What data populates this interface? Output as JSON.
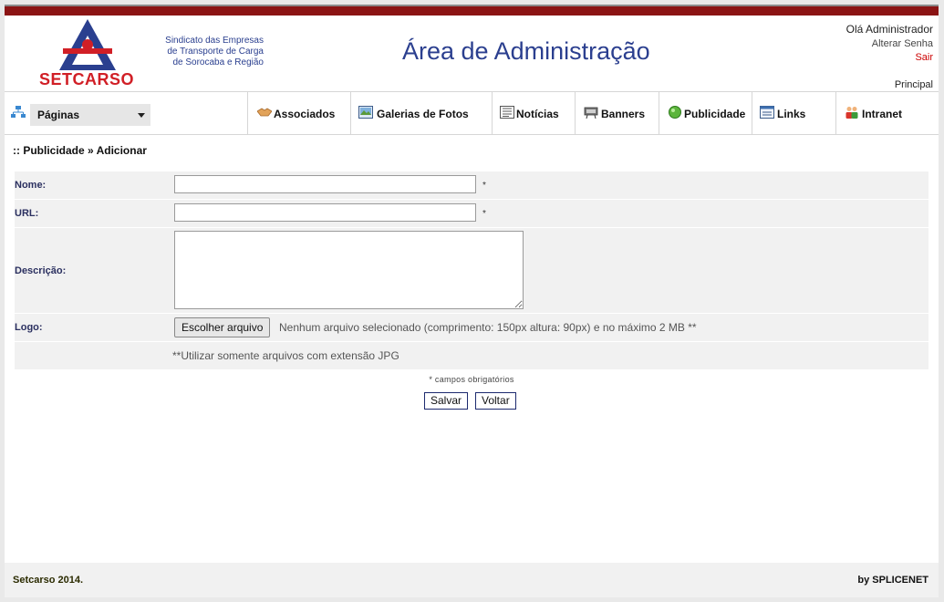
{
  "header": {
    "logo_text": "SETCARSO",
    "logo_subtitle": [
      "Sindicato das Empresas",
      "de Transporte de Carga",
      "de Sorocaba e Região"
    ],
    "title": "Área de Administração",
    "greeting": "Olá Administrador",
    "change_password": "Alterar Senha",
    "logout": "Sair",
    "home": "Principal"
  },
  "menu": {
    "pages_label": "Páginas",
    "items": [
      {
        "label": "Associados",
        "icon": "handshake-icon"
      },
      {
        "label": "Galerias de Fotos",
        "icon": "photo-gallery-icon"
      },
      {
        "label": "Notícias",
        "icon": "news-icon"
      },
      {
        "label": "Banners",
        "icon": "banner-icon"
      },
      {
        "label": "Publicidade",
        "icon": "green-circle-icon"
      },
      {
        "label": "Links",
        "icon": "links-icon"
      },
      {
        "label": "Intranet",
        "icon": "people-icon"
      }
    ]
  },
  "breadcrumb": ":: Publicidade » Adicionar",
  "form": {
    "name_label": "Nome:",
    "name_value": "",
    "url_label": "URL:",
    "url_value": "",
    "required_mark": "*",
    "description_label": "Descrição:",
    "description_value": "",
    "logo_label": "Logo:",
    "file_button": "Escolher arquivo",
    "file_info": "Nenhum arquivo selecionado  (comprimento: 150px altura: 90px) e no máximo 2 MB **",
    "jpg_note": "**Utilizar somente arquivos com extensão JPG",
    "required_note": "* campos obrigatórios",
    "save_label": "Salvar",
    "back_label": "Voltar"
  },
  "footer": {
    "left": "Setcarso 2014.",
    "right": "by SPLICENET"
  },
  "colors": {
    "brand_red": "#8b1414",
    "brand_blue": "#2b3f8f",
    "logo_red": "#d11f26"
  }
}
